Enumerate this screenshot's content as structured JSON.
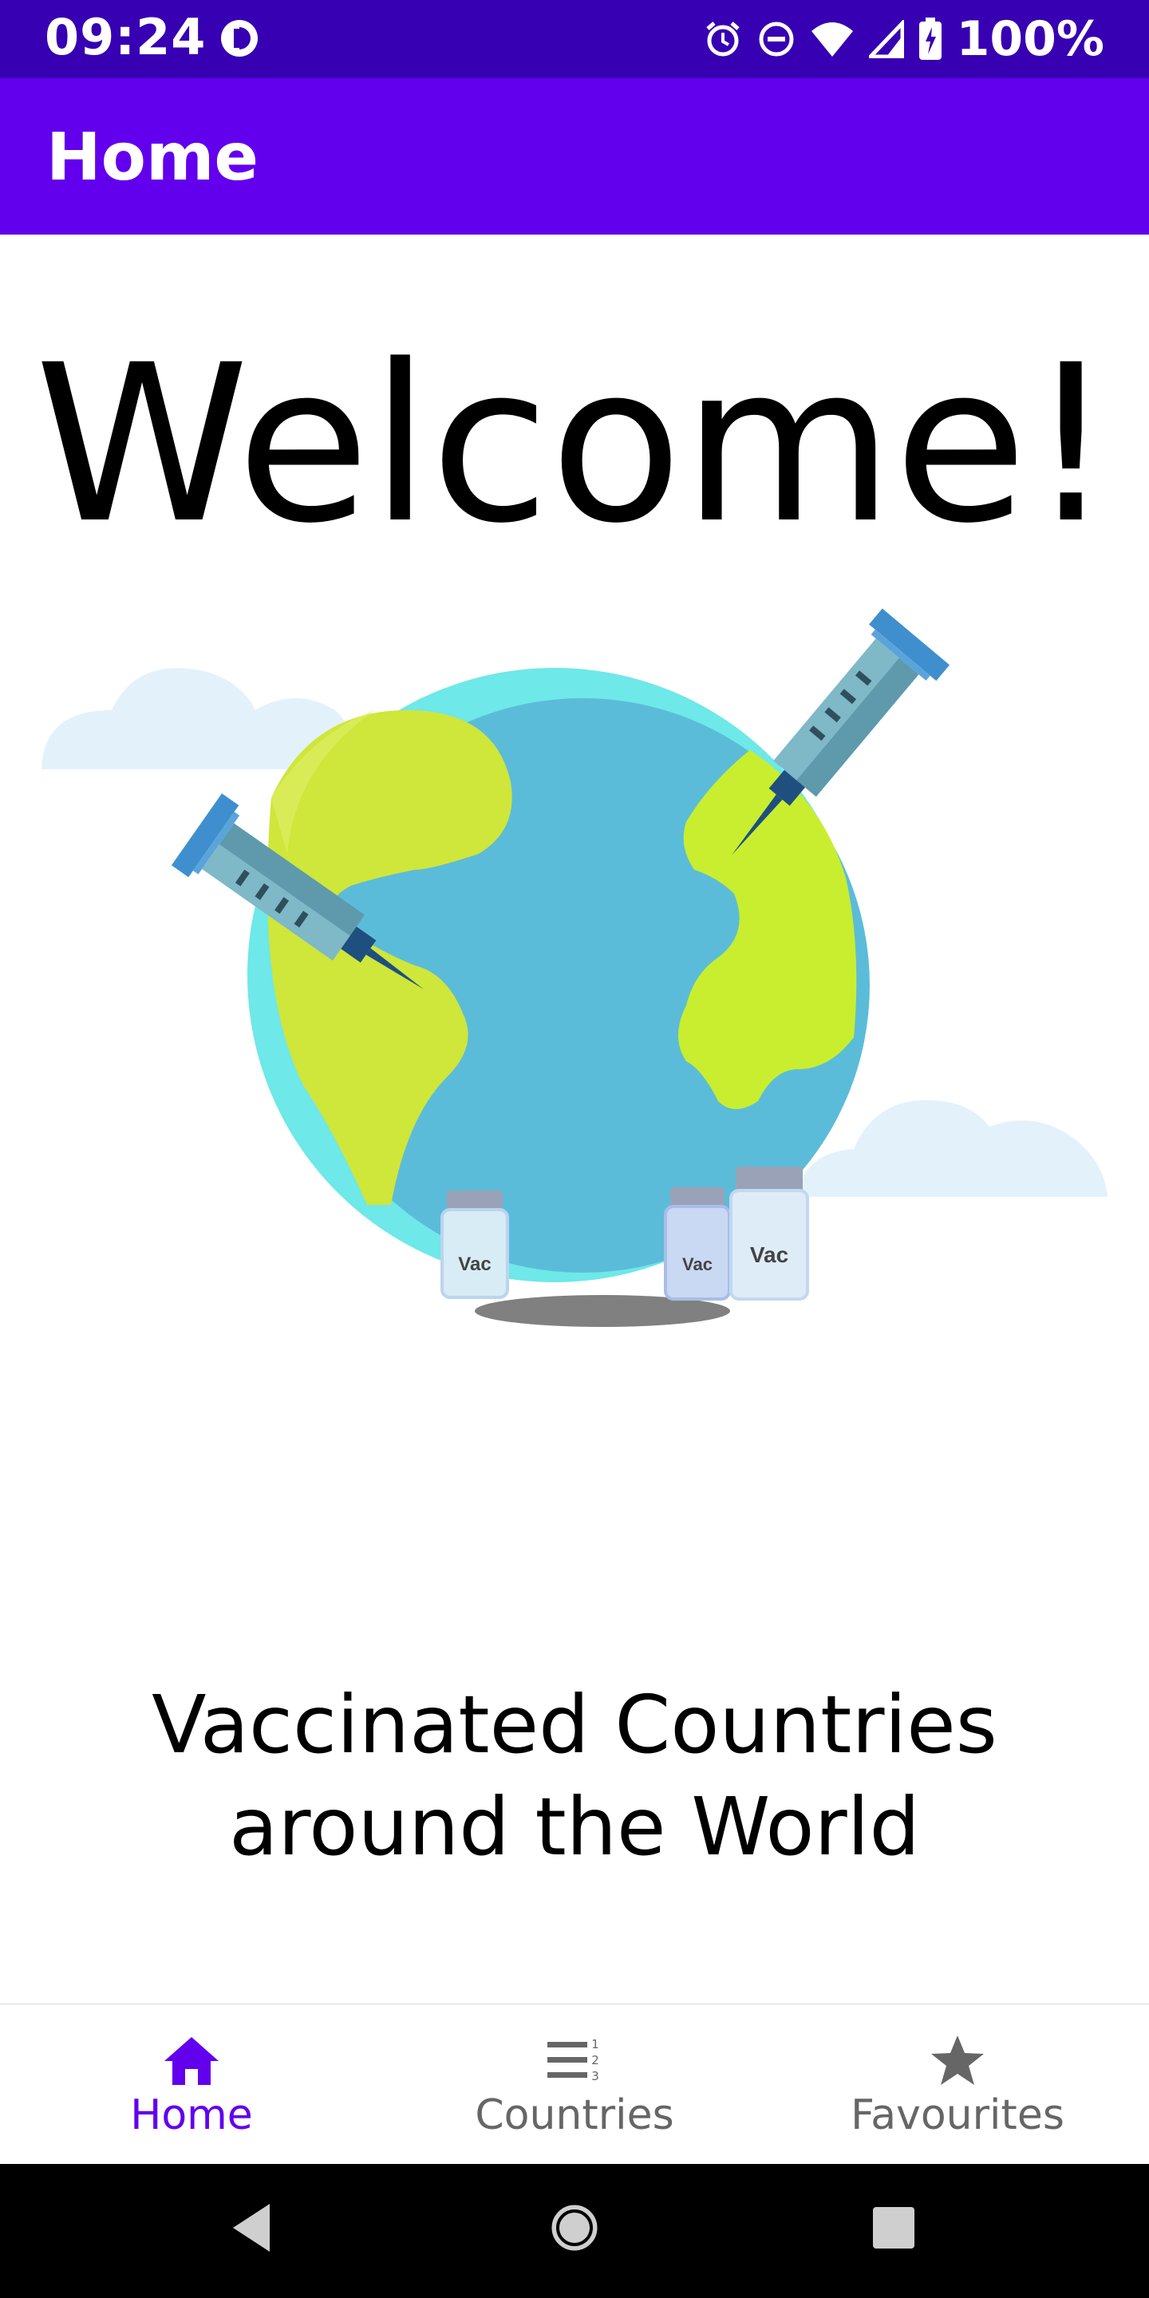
{
  "status_bar": {
    "time": "09:24",
    "battery": "100%",
    "icons": [
      "data-saver-icon",
      "alarm-icon",
      "do-not-disturb-icon",
      "wifi-icon",
      "signal-icon",
      "battery-icon"
    ]
  },
  "app_bar": {
    "title": "Home"
  },
  "main": {
    "welcome": "Welcome!",
    "subtitle_line1": "Vaccinated Countries",
    "subtitle_line2": "around the World",
    "illustration": {
      "vial_labels": [
        "Vac",
        "Vac",
        "Vac"
      ]
    }
  },
  "bottom_nav": {
    "items": [
      {
        "label": "Home",
        "icon": "home-icon",
        "active": true
      },
      {
        "label": "Countries",
        "icon": "numbered-list-icon",
        "active": false
      },
      {
        "label": "Favourites",
        "icon": "star-icon",
        "active": false
      }
    ]
  },
  "colors": {
    "status_bar": "#3700b3",
    "app_bar": "#6200ee",
    "accent": "#6200ee",
    "nav_inactive": "#666666"
  }
}
